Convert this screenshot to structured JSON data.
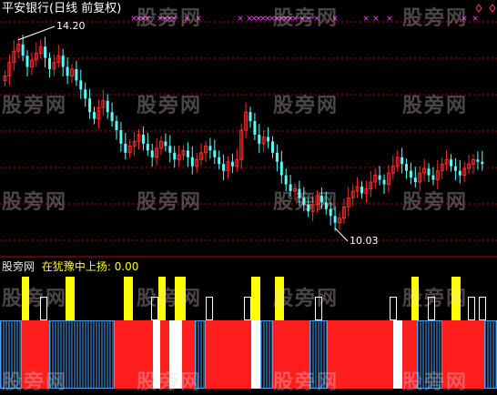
{
  "chart": {
    "title": "平安银行(日线 前复权)",
    "high_label": "14.20",
    "low_label": "10.03"
  },
  "indicator": {
    "prefix": "股旁网",
    "name": "在犹豫中上扬:",
    "value": "0.00"
  },
  "watermark": "股旁网",
  "colors": {
    "background": "#000000",
    "candle_up": "#ff2a2a",
    "candle_down": "#54ffff",
    "grid": "#c40000",
    "marker_purple": "#ff44ff",
    "bar_red": "#ff1e1e",
    "bar_yellow": "#ffff00",
    "bar_blue": "#4ba3ff",
    "bar_white": "#ffffff",
    "diamond": "#ff4040"
  },
  "chart_data": {
    "type": "candlestick",
    "price_range": [
      9.6,
      14.8
    ],
    "high": 14.2,
    "low": 10.03,
    "close": [
      13.4,
      13.7,
      13.95,
      14.1,
      13.85,
      13.6,
      13.75,
      13.9,
      14.05,
      13.8,
      13.55,
      13.7,
      13.85,
      13.6,
      13.4,
      13.55,
      13.3,
      13.1,
      12.9,
      12.6,
      12.45,
      12.7,
      12.85,
      12.6,
      12.4,
      12.2,
      11.9,
      11.7,
      11.85,
      11.95,
      12.1,
      11.9,
      11.75,
      11.6,
      11.8,
      11.95,
      11.85,
      11.7,
      11.55,
      11.65,
      11.75,
      11.6,
      11.4,
      11.55,
      11.7,
      11.85,
      11.75,
      11.6,
      11.45,
      11.3,
      11.5,
      11.4,
      11.55,
      12.2,
      12.6,
      12.4,
      12.1,
      11.9,
      12.05,
      11.95,
      11.7,
      11.5,
      11.2,
      11.0,
      10.85,
      10.9,
      10.7,
      10.55,
      10.4,
      10.55,
      10.75,
      10.6,
      10.45,
      10.3,
      10.15,
      10.25,
      10.5,
      10.7,
      10.85,
      10.95,
      10.8,
      10.9,
      11.05,
      11.2,
      11.1,
      11.0,
      11.25,
      11.4,
      11.6,
      11.45,
      11.3,
      11.15,
      11.05,
      11.25,
      11.35,
      11.2,
      11.1,
      11.3,
      11.45,
      11.55,
      11.4,
      11.3,
      11.2,
      11.35,
      11.45,
      11.55,
      11.5,
      11.45
    ],
    "signal_markers_x": [
      147,
      152,
      157,
      162,
      176,
      181,
      186,
      191,
      205,
      218,
      264,
      274,
      279,
      284,
      289,
      294,
      299,
      304,
      309,
      314,
      319,
      324,
      332,
      339,
      348,
      368,
      402,
      413,
      428,
      510,
      522
    ],
    "bars": [
      "red",
      "yellow",
      "red",
      "blue",
      "white",
      "red",
      "blue",
      "red",
      "yellow",
      "white",
      "red",
      "yellow",
      "white",
      "red"
    ]
  }
}
